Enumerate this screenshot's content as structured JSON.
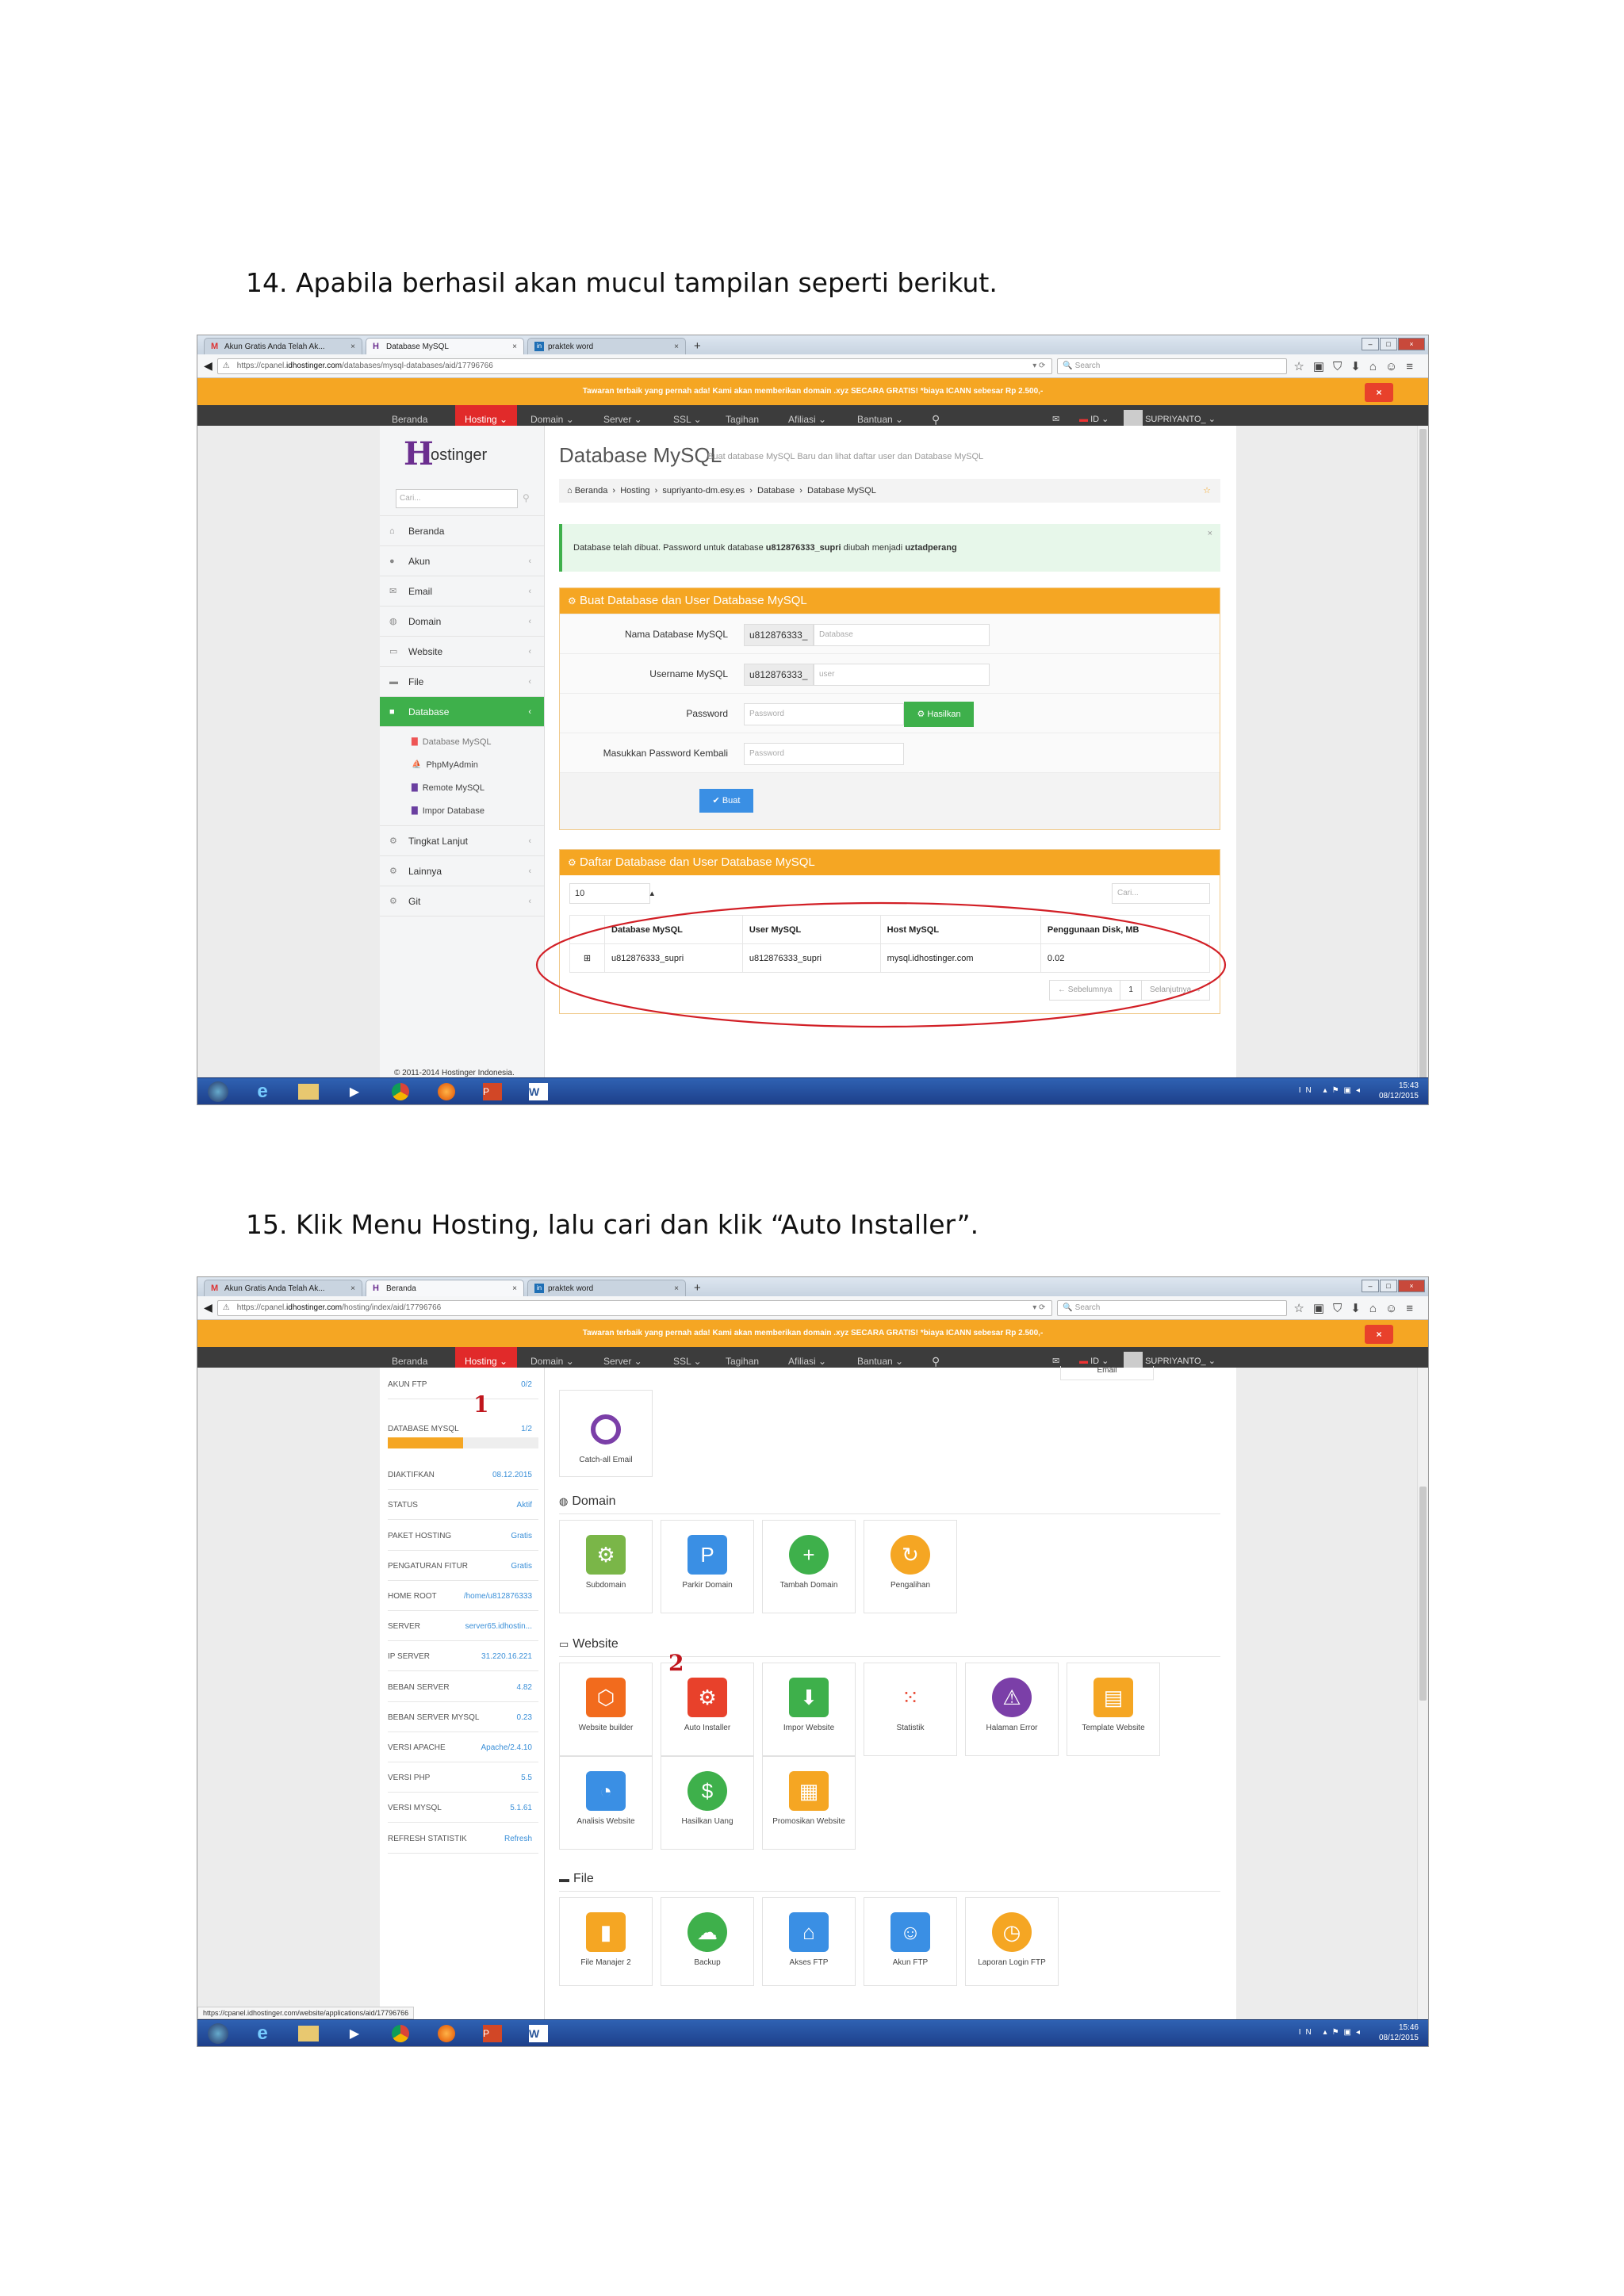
{
  "doc": {
    "step14": "14.  Apabila berhasil akan mucul tampilan seperti berikut.",
    "step15": "15.  Klik Menu Hosting, lalu cari dan klik “Auto Installer”."
  },
  "browser": {
    "tabs": [
      "Akun Gratis Anda Telah Ak...",
      "Database MySQL",
      "praktek word"
    ],
    "tabs2": [
      "Akun Gratis Anda Telah Ak...",
      "Beranda",
      "praktek word"
    ],
    "url1_pre": "https://cpanel.",
    "url1_host": "idhostinger.com",
    "url1_post": "/databases/mysql-databases/aid/17796766",
    "url2_pre": "https://cpanel.",
    "url2_host": "idhostinger.com",
    "url2_post": "/hosting/index/aid/17796766",
    "search_placeholder": "Search"
  },
  "promo": {
    "text": "Tawaran terbaik yang pernah ada! Kami akan memberikan domain .xyz SECARA GRATIS! *biaya ICANN sebesar Rp 2.500,-",
    "close": "×"
  },
  "nav": {
    "items": [
      "Beranda",
      "Hosting",
      "Domain",
      "Server",
      "SSL",
      "Tagihan",
      "Afiliasi",
      "Bantuan"
    ],
    "lang": "ID",
    "user": "SUPRIYANTO_"
  },
  "sidebar": {
    "logo": "ostinger",
    "search_placeholder": "Cari...",
    "items": [
      "Beranda",
      "Akun",
      "Email",
      "Domain",
      "Website",
      "File",
      "Database"
    ],
    "subitems": [
      "Database MySQL",
      "PhpMyAdmin",
      "Remote MySQL",
      "Impor Database"
    ],
    "items2": [
      "Tingkat Lanjut",
      "Lainnya",
      "Git"
    ],
    "footer": "© 2011-2014 Hostinger Indonesia."
  },
  "db_page": {
    "title": "Database MySQL",
    "subtitle": "Buat database MySQL Baru dan lihat daftar user dan Database MySQL",
    "breadcrumb": [
      "Beranda",
      "Hosting",
      "supriyanto-dm.esy.es",
      "Database",
      "Database MySQL"
    ],
    "alert_pre": "Database telah dibuat. Password untuk database ",
    "alert_db": "u812876333_supri",
    "alert_mid": " diubah menjadi ",
    "alert_pw": "uztadperang",
    "create_title": "Buat Database dan User Database MySQL",
    "label_db": "Nama Database MySQL",
    "prefix": "u812876333_",
    "ph_db": "Database",
    "label_user": "Username MySQL",
    "ph_user": "user",
    "label_pw": "Password",
    "ph_pw": "Password",
    "gen_btn": "Hasilkan",
    "label_pw2": "Masukkan Password Kembali",
    "ph_pw2": "Password",
    "create_btn": "Buat",
    "list_title": "Daftar Database dan User Database MySQL",
    "page_size": "10",
    "search_ph": "Cari...",
    "columns": [
      "Database MySQL",
      "User MySQL",
      "Host MySQL",
      "Penggunaan Disk, MB"
    ],
    "row": [
      "u812876333_supri",
      "u812876333_supri",
      "mysql.idhostinger.com",
      "0.02"
    ],
    "prev": "← Sebelumnya",
    "page": "1",
    "next": "Selanjutnya →"
  },
  "hosting_page": {
    "stats": [
      [
        "AKUN FTP",
        "0/2"
      ],
      [
        "DATABASE MYSQL",
        "1/2"
      ],
      [
        "DIAKTIFKAN",
        "08.12.2015"
      ],
      [
        "STATUS",
        "Aktif"
      ],
      [
        "PAKET HOSTING",
        "Gratis"
      ],
      [
        "PENGATURAN FITUR",
        "Gratis"
      ],
      [
        "HOME ROOT",
        "/home/u812876333"
      ],
      [
        "SERVER",
        "server65.idhostin..."
      ],
      [
        "IP SERVER",
        "31.220.16.221"
      ],
      [
        "BEBAN SERVER",
        "4.82"
      ],
      [
        "BEBAN SERVER MYSQL",
        "0.23"
      ],
      [
        "VERSI APACHE",
        "Apache/2.4.10"
      ],
      [
        "VERSI PHP",
        "5.5"
      ],
      [
        "VERSI MYSQL",
        "5.1.61"
      ],
      [
        "REFRESH STATISTIK",
        "Refresh"
      ]
    ],
    "email_partial": "Email",
    "catchall": "Catch-all Email",
    "sec_domain": "Domain",
    "domain_tiles": [
      "Subdomain",
      "Parkir Domain",
      "Tambah Domain",
      "Pengalihan"
    ],
    "sec_website": "Website",
    "website_tiles": [
      "Website builder",
      "Auto Installer",
      "Impor Website",
      "Statistik",
      "Halaman Error",
      "Template Website"
    ],
    "website_tiles2": [
      "Analisis Website",
      "Hasilkan Uang",
      "Promosikan Website"
    ],
    "sec_file": "File",
    "file_tiles": [
      "File Manajer 2",
      "Backup",
      "Akses FTP",
      "Akun FTP",
      "Laporan Login FTP"
    ],
    "status_url": "https://cpanel.idhostinger.com/website/applications/aid/17796766",
    "mark1": "1",
    "mark2": "2"
  },
  "taskbar": {
    "lang": "IN",
    "time1": "15:43",
    "date1": "08/12/2015",
    "time2": "15:46",
    "date2": "08/12/2015"
  },
  "colors": {
    "orange": "#f5a623",
    "red": "#e12a2a",
    "green": "#3eb04b",
    "dark": "#3c3c3c",
    "blue_btn": "#3a8fe4"
  }
}
